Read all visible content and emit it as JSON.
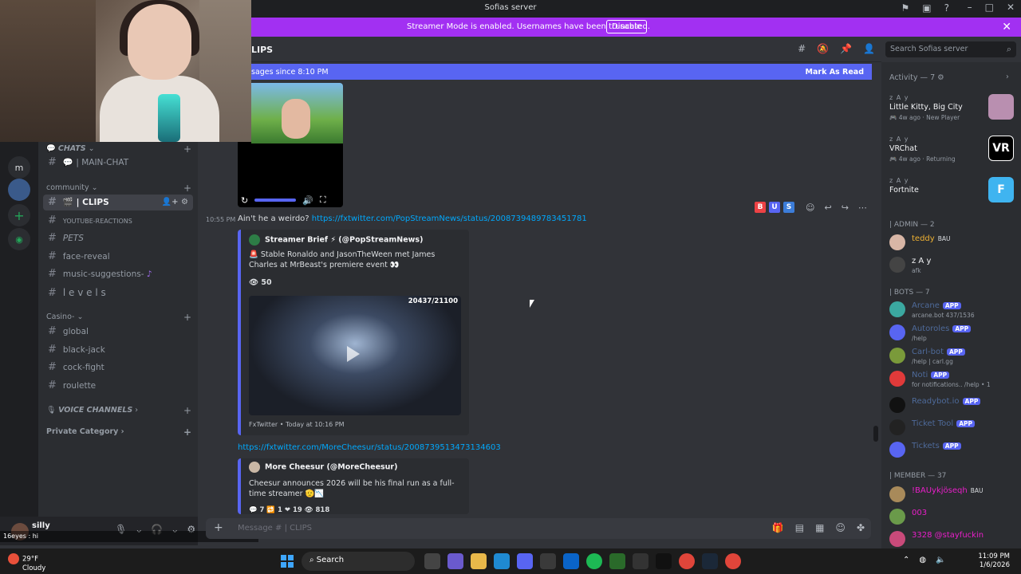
{
  "window": {
    "title": "Sofias server"
  },
  "banner": {
    "text": "Streamer Mode is enabled. Usernames have been truncated.",
    "button": "Disable"
  },
  "channel_header": {
    "title": "LIPS"
  },
  "search": {
    "placeholder": "Search Sofias server"
  },
  "new_messages": {
    "text": "sages since 8:10 PM",
    "action": "Mark As Read"
  },
  "server_rail": {
    "letter": "m"
  },
  "channel_list": {
    "categories": [
      {
        "label": "CHATS",
        "channels": [
          {
            "name": "| MAIN-CHAT"
          }
        ]
      },
      {
        "label": "community",
        "channels": [
          {
            "name": "| CLIPS",
            "active": true
          },
          {
            "name": "YOUTUBE-REACTIONS"
          },
          {
            "name": "PETS"
          },
          {
            "name": "face-reveal"
          },
          {
            "name": "music-suggestions-"
          },
          {
            "name": "l e v e l s"
          }
        ]
      },
      {
        "label": "Casino-",
        "channels": [
          {
            "name": "global"
          },
          {
            "name": "black-jack"
          },
          {
            "name": "cock-fight"
          },
          {
            "name": "roulette"
          }
        ]
      },
      {
        "label": "VOICE CHANNELS",
        "channels": []
      },
      {
        "label": "Private Category",
        "channels": []
      }
    ]
  },
  "user": {
    "name": "silly",
    "chat_line": "16eyes : hi"
  },
  "messages": [
    {
      "time": "10:55 PM",
      "text": "Ain't he a weirdo?",
      "link": "https://fxtwitter.com/PopStreamNews/status/2008739489783451781",
      "tags": [
        "B",
        "U",
        "S"
      ],
      "embed": {
        "author": "Streamer Brief ⚡ (@PopStreamNews)",
        "description": "🚨 Stable Ronaldo and JasonTheWeen met James Charles at MrBeast's premiere event 👀",
        "views": "50",
        "media_counter": "20437/21100",
        "footer": "FxTwitter • Today at 10:16 PM"
      }
    },
    {
      "link": "https://fxtwitter.com/MoreCheesur/status/2008739513473134603",
      "embed": {
        "author": "More Cheesur (@MoreCheesur)",
        "description": "Cheesur announces 2026 will be his final run as a full-time streamer 🫡📉",
        "stats": {
          "replies": "7",
          "retweets": "1",
          "likes": "19",
          "views": "818"
        }
      }
    }
  ],
  "composer": {
    "placeholder": "Message # | CLIPS"
  },
  "activity": {
    "header": "Activity — 7",
    "items": [
      {
        "user": "z A y",
        "game": "Little Kitty, Big City",
        "meta": "4w ago",
        "status": "New Player"
      },
      {
        "user": "z A y",
        "game": "VRChat",
        "meta": "4w ago",
        "status": "Returning",
        "art": "VR"
      },
      {
        "user": "z A y",
        "game": "Fortnite",
        "meta": "",
        "status": "",
        "art": "F"
      }
    ]
  },
  "members": {
    "admin_header": "| ADMIN — 2",
    "admins": [
      {
        "name": "teddy",
        "badge": "BAU",
        "color": "#f0b232"
      },
      {
        "name": "z A y",
        "status": "afk",
        "color": "#f2f3f5"
      }
    ],
    "bots_header": "| BOTS — 7",
    "bots": [
      {
        "name": "Arcane",
        "status": "arcane.bot 437/1536",
        "color": "#4e6a9a"
      },
      {
        "name": "Autoroles",
        "status": "/help",
        "color": "#4e6a9a"
      },
      {
        "name": "Carl-bot",
        "status": "/help | carl.gg",
        "color": "#4e6a9a"
      },
      {
        "name": "Noti",
        "status": "for notifications.. /help • 1",
        "color": "#4e6a9a"
      },
      {
        "name": "Readybot.io",
        "status": "",
        "color": "#4e6a9a"
      },
      {
        "name": "Ticket Tool",
        "status": "",
        "color": "#4e6a9a"
      },
      {
        "name": "Tickets",
        "status": "",
        "color": "#4e6a9a"
      }
    ],
    "members_header": "| MEMBER — 37",
    "members": [
      {
        "name": "!BAUykjöseqh",
        "badge": "BAU",
        "color": "#e91ec9"
      },
      {
        "name": "003",
        "color": "#e91ec9"
      },
      {
        "name": "3328 @stayfuckin",
        "color": "#e91ec9"
      }
    ],
    "app_label": "APP"
  },
  "taskbar": {
    "weather_temp": "29°F",
    "weather_desc": "Cloudy",
    "search": "Search",
    "time": "11:09 PM",
    "date": "1/6/2026"
  }
}
